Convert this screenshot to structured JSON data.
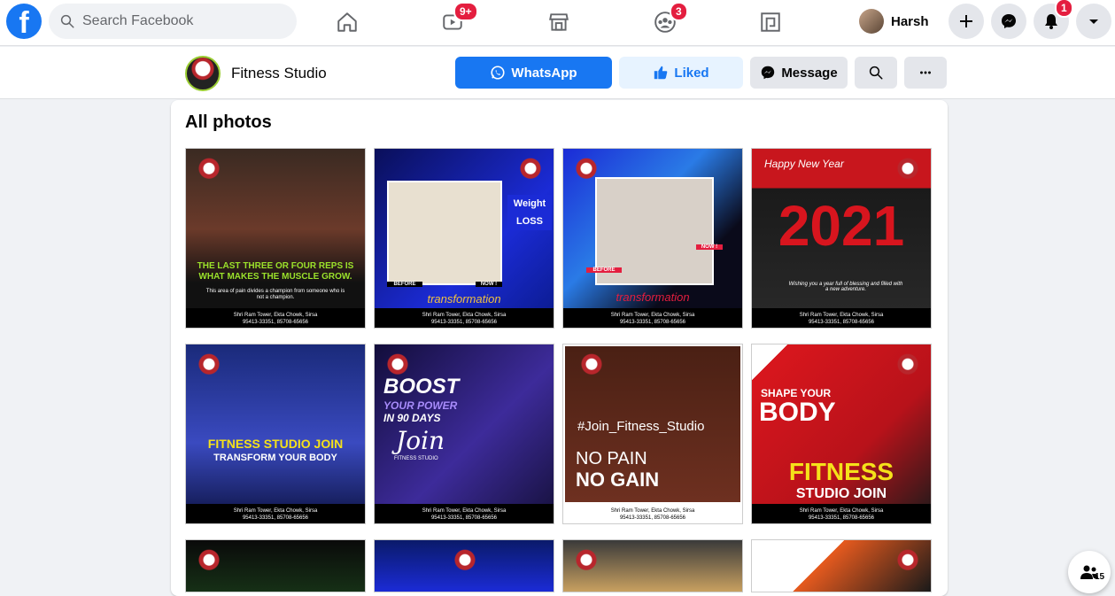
{
  "nav": {
    "logo": "f",
    "search_placeholder": "Search Facebook",
    "video_badge": "9+",
    "groups_badge": "3",
    "profile_name": "Harsh",
    "notifications_badge": "1"
  },
  "page": {
    "name": "Fitness Studio",
    "whatsapp_label": "WhatsApp",
    "liked_label": "Liked",
    "message_label": "Message"
  },
  "photos": {
    "title": "All photos",
    "brand": "FITNESS\nSTUDIO",
    "address": "Shri Ram Tower, Ekta Chowk, Sirsa",
    "phones": "95413-33351, 85708-65656",
    "items": [
      {
        "caption": "THE LAST THREE OR FOUR REPS IS WHAT MAKES THE MUSCLE GROW.",
        "sub": "This area of pain divides a champion from someone who is not a champion."
      },
      {
        "caption": "Weight LOSS",
        "sub": "transformation",
        "before": "BEFORE",
        "now": "NOW !"
      },
      {
        "caption": "transformation",
        "before": "BEFORE",
        "now": "NOW !"
      },
      {
        "caption": "Happy New Year",
        "year": "2021",
        "sub": "Wishing you a year full of blessing and filled with a new adventure."
      },
      {
        "caption": "FITNESS STUDIO JOIN",
        "sub": "TRANSFORM YOUR BODY"
      },
      {
        "caption": "BOOST",
        "line2": "YOUR POWER",
        "line3": "IN 90 DAYS",
        "sub": "Join",
        "sub2": "FITNESS STUDIO"
      },
      {
        "caption": "#Join_Fitness_Studio",
        "line2": "NO PAIN",
        "line3": "NO GAIN"
      },
      {
        "caption": "SHAPE YOUR",
        "line2": "BODY",
        "line3": "FITNESS",
        "sub": "STUDIO JOIN"
      }
    ]
  },
  "online_count": "15",
  "colors": {
    "brand_blue": "#1877f2",
    "badge_red": "#e41e3f",
    "liked_bg": "#e7f3ff"
  }
}
